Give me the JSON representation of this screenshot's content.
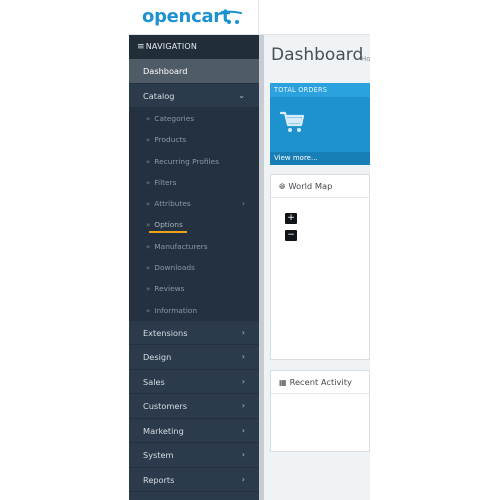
{
  "brand": {
    "logo_text": "opencart"
  },
  "navigation": {
    "header": "NAVIGATION",
    "items_top": [
      {
        "label": "Dashboard",
        "active": true
      },
      {
        "label": "Catalog",
        "open": true
      }
    ],
    "catalog_sub": [
      {
        "label": "Categories"
      },
      {
        "label": "Products"
      },
      {
        "label": "Recurring Profiles"
      },
      {
        "label": "Filters"
      },
      {
        "label": "Attributes",
        "has_children": true
      },
      {
        "label": "Options",
        "selected": true
      },
      {
        "label": "Manufacturers"
      },
      {
        "label": "Downloads"
      },
      {
        "label": "Reviews"
      },
      {
        "label": "Information"
      }
    ],
    "items_bottom": [
      {
        "label": "Extensions"
      },
      {
        "label": "Design"
      },
      {
        "label": "Sales"
      },
      {
        "label": "Customers"
      },
      {
        "label": "Marketing"
      },
      {
        "label": "System"
      },
      {
        "label": "Reports"
      }
    ]
  },
  "page": {
    "title": "Dashboard",
    "breadcrumb": "Ho"
  },
  "tile": {
    "title": "TOTAL ORDERS",
    "link": "View more..."
  },
  "map_panel": {
    "title": "World Map",
    "zoom_in": "+",
    "zoom_out": "−"
  },
  "activity_panel": {
    "title": "Recent Activity"
  },
  "colors": {
    "accent": "#1e91cf",
    "sidebar": "#2b3b4b",
    "highlight": "#f0a11a"
  }
}
